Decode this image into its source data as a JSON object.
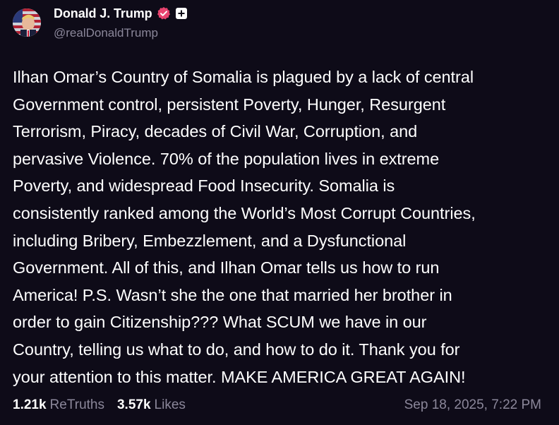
{
  "author": {
    "display_name": "Donald J. Trump",
    "handle": "@realDonaldTrump"
  },
  "post": {
    "text": "Ilhan Omar’s Country of Somalia is plagued by a lack of central\nGovernment control, persistent Poverty, Hunger, Resurgent\nTerrorism, Piracy, decades of Civil War, Corruption, and\npervasive Violence. 70% of the population lives in extreme\nPoverty, and widespread Food Insecurity. Somalia is\nconsistently ranked among the World’s Most Corrupt Countries,\nincluding Bribery, Embezzlement, and a Dysfunctional\nGovernment. All of this, and Ilhan Omar tells us how to run\nAmerica! P.S. Wasn’t she the one that married her brother in\norder to gain Citizenship??? What SCUM we have in our\nCountry, telling us what to do, and how to do it. Thank you for\nyour attention to this matter. MAKE AMERICA GREAT AGAIN!"
  },
  "stats": {
    "retruths_count": "1.21k",
    "retruths_label": "ReTruths",
    "likes_count": "3.57k",
    "likes_label": "Likes"
  },
  "timestamp": "Sep 18, 2025, 7:22 PM",
  "icons": {
    "verified": "verified-badge-icon",
    "follow": "plus-icon"
  },
  "colors": {
    "background": "#0e0b18",
    "text": "#ffffff",
    "muted": "#8b879a",
    "verified": "#e8436f"
  }
}
